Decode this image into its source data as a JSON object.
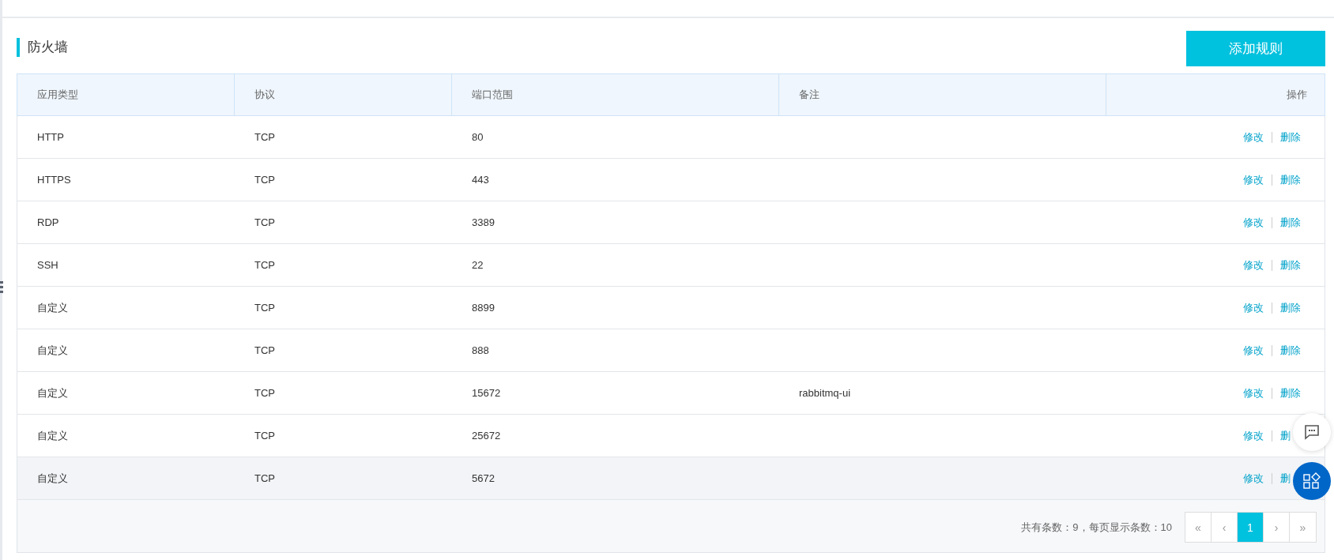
{
  "section": {
    "title": "防火墙",
    "add_button": "添加规则"
  },
  "table": {
    "columns": [
      "应用类型",
      "协议",
      "端口范围",
      "备注",
      "操作"
    ],
    "rows": [
      {
        "type": "HTTP",
        "protocol": "TCP",
        "ports": "80",
        "note": "",
        "edit": "修改",
        "delete": "删除",
        "highlighted": false
      },
      {
        "type": "HTTPS",
        "protocol": "TCP",
        "ports": "443",
        "edit": "修改",
        "delete": "删除",
        "highlighted": false
      },
      {
        "type": "RDP",
        "protocol": "TCP",
        "ports": "3389",
        "edit": "修改",
        "delete": "删除",
        "highlighted": false
      },
      {
        "type": "SSH",
        "protocol": "TCP",
        "ports": "22",
        "edit": "修改",
        "delete": "删除",
        "highlighted": false
      },
      {
        "type": "自定义",
        "protocol": "TCP",
        "ports": "8899",
        "edit": "修改",
        "delete": "删除",
        "highlighted": false
      },
      {
        "type": "自定义",
        "protocol": "TCP",
        "ports": "888",
        "edit": "修改",
        "delete": "删除",
        "highlighted": false
      },
      {
        "type": "自定义",
        "protocol": "TCP",
        "ports": "15672",
        "note": "rabbitmq-ui",
        "edit": "修改",
        "delete": "删除",
        "highlighted": false
      },
      {
        "type": "自定义",
        "protocol": "TCP",
        "ports": "25672",
        "edit": "修改",
        "delete": "删",
        "highlighted": false
      },
      {
        "type": "自定义",
        "protocol": "TCP",
        "ports": "5672",
        "edit": "修改",
        "delete": "删",
        "highlighted": true
      }
    ]
  },
  "pagination": {
    "summary": "共有条数：9，每页显示条数：10",
    "pages": [
      {
        "label": "«",
        "selected": false
      },
      {
        "label": "‹",
        "selected": false
      },
      {
        "label": "1",
        "selected": true
      },
      {
        "label": "›",
        "selected": false
      },
      {
        "label": "»",
        "selected": false
      }
    ]
  }
}
